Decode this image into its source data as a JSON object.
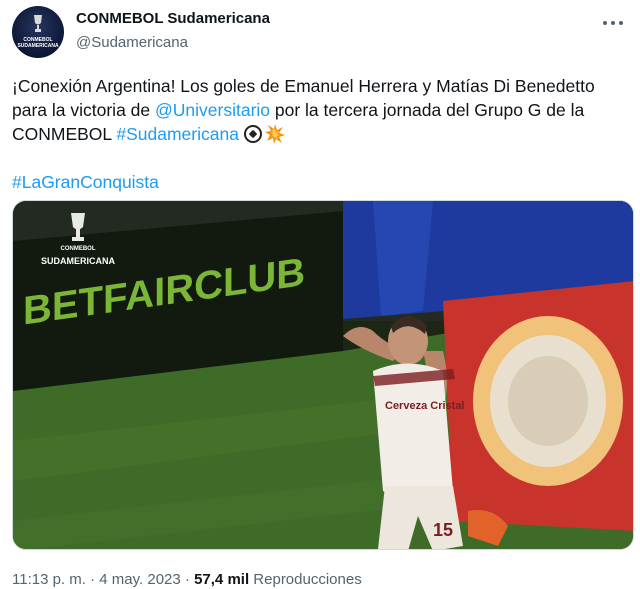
{
  "tweet": {
    "author_name": "CONMEBOL Sudamericana",
    "author_handle": "@Sudamericana",
    "avatar_label": "CONMEBOL SUDAMERICANA",
    "text_part1": "¡Conexión Argentina! Los goles de Emanuel Herrera y Matías Di Benedetto para la victoria de ",
    "mention": "@Universitario",
    "text_part2": " por la tercera jornada del Grupo G de la CONMEBOL ",
    "hashtag_inline": "#Sudamericana",
    "hashtag_line": "#LaGranConquista",
    "emojis": [
      "soccer-ball",
      "collision"
    ]
  },
  "media": {
    "watermark_top": "CONMEBOL",
    "watermark_bottom": "SUDAMERICANA",
    "board_text": "BETFAIRCLUB",
    "shirt_text": "Cerveza Cristal",
    "shirt_number": "15"
  },
  "footer": {
    "time": "11:13 p. m.",
    "separator": "·",
    "date": "4 may. 2023",
    "views_count": "57,4 mil",
    "views_label": "Reproducciones"
  },
  "colors": {
    "link": "#1d9bf0",
    "secondary_text": "#536471",
    "pitch": "#3f6b28",
    "shirt": "#f2ede6",
    "shirt_stripe": "#7a1d22"
  }
}
